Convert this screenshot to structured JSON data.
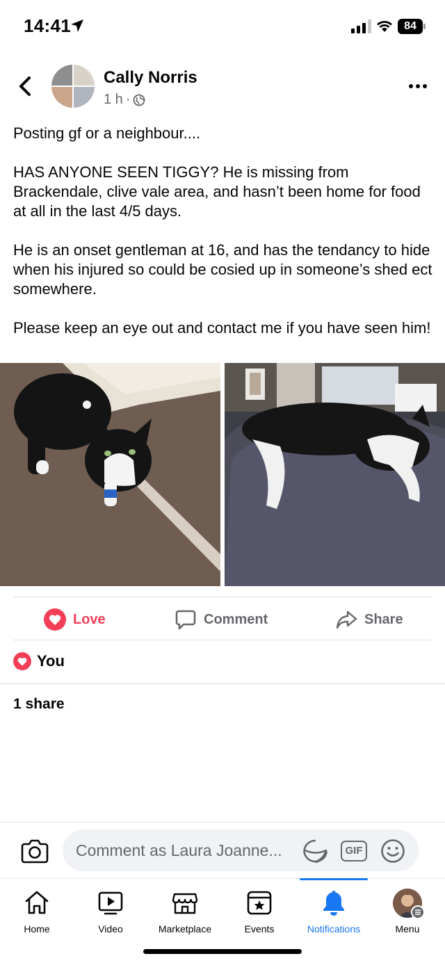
{
  "status_bar": {
    "time": "14:41",
    "battery": "84"
  },
  "post": {
    "author": "Cally Norris",
    "time_ago": "1 h",
    "paragraphs": [
      "Posting gf or a neighbour....",
      "HAS ANYONE SEEN TIGGY? He is missing from Brackendale, clive vale area, and hasn’t been home for food at all in the last 4/5 days.",
      "He is an onset gentleman at 16, and has the tendancy to hide when his injured so could be cosied up in someone’s shed ect somewhere.",
      "Please keep an eye out and contact me if you have seen him!"
    ]
  },
  "actions": {
    "love": "Love",
    "comment": "Comment",
    "share": "Share"
  },
  "reactions": {
    "label": "You"
  },
  "shares": {
    "label": "1 share"
  },
  "composer": {
    "placeholder": "Comment as Laura Joanne...",
    "gif": "GIF"
  },
  "nav": {
    "items": [
      {
        "label": "Home",
        "icon": "home-icon"
      },
      {
        "label": "Video",
        "icon": "video-icon"
      },
      {
        "label": "Marketplace",
        "icon": "marketplace-icon"
      },
      {
        "label": "Events",
        "icon": "events-icon"
      },
      {
        "label": "Notifications",
        "icon": "bell-icon",
        "active": true
      },
      {
        "label": "Menu",
        "icon": "profile-avatar"
      }
    ]
  },
  "colors": {
    "accent": "#1877f2",
    "love": "#f33e58",
    "secondary_text": "#65676b"
  }
}
